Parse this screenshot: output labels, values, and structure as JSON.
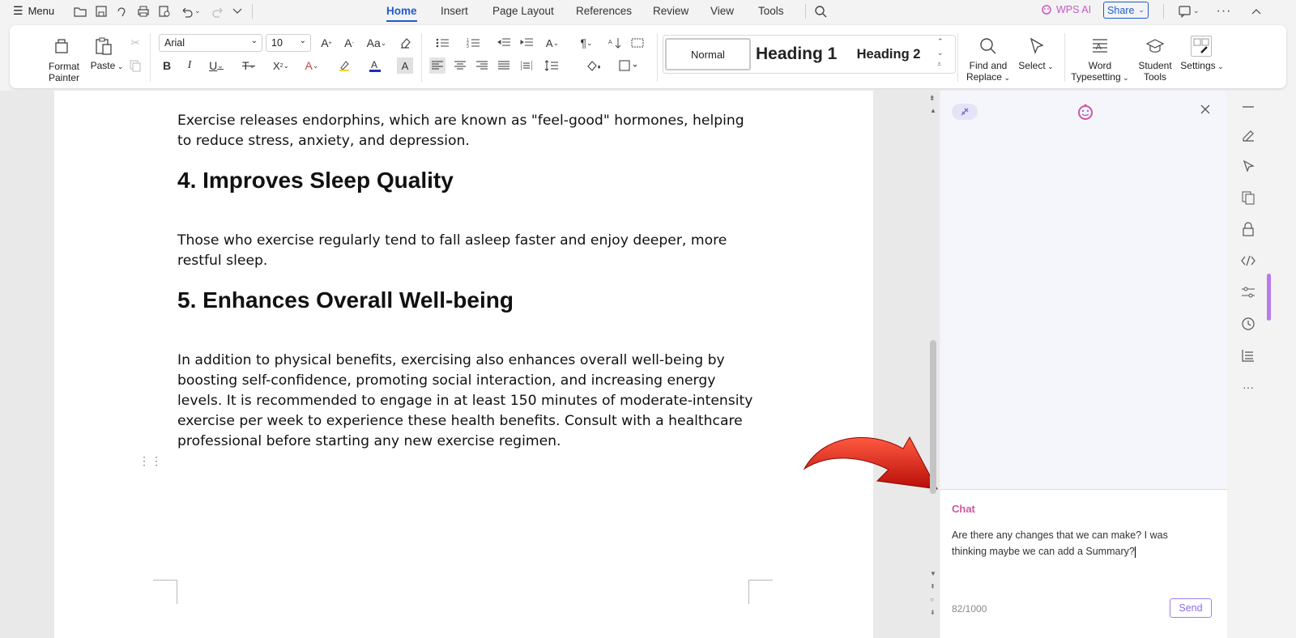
{
  "topbar": {
    "menu_label": "Menu",
    "tabs": [
      "Home",
      "Insert",
      "Page Layout",
      "References",
      "Review",
      "View",
      "Tools"
    ],
    "active_tab": "Home",
    "wps_ai": "WPS AI",
    "share": "Share"
  },
  "ribbon": {
    "format_painter": "Format Painter",
    "paste": "Paste",
    "font_name": "Arial",
    "font_size": "10",
    "styles": {
      "normal": "Normal",
      "heading1": "Heading 1",
      "heading2": "Heading 2"
    },
    "find_replace": "Find and Replace",
    "select": "Select",
    "word_typesetting": "Word Typesetting",
    "student_tools": "Student Tools",
    "settings": "Settings"
  },
  "document": {
    "para1": "Exercise releases endorphins, which are known as \"feel-good\" hormones, helping to reduce stress, anxiety, and depression.",
    "heading4": "4. Improves Sleep Quality",
    "para2": "Those who exercise regularly tend to fall asleep faster and enjoy deeper, more restful sleep.",
    "heading5": "5. Enhances Overall Well-being",
    "para3": "In addition to physical benefits, exercising also enhances overall well-being by boosting self-confidence, promoting social interaction, and increasing energy levels. It is recommended to engage in at least 150 minutes of moderate-intensity exercise per week to experience these health benefits. Consult with a healthcare professional before starting any new exercise regimen."
  },
  "ai_panel": {
    "chat_label": "Chat",
    "input_text": "Are there any changes that we can make? I was thinking maybe we can add a Summary?",
    "char_count": "82/1000",
    "send": "Send"
  },
  "colors": {
    "accent": "#1f5bd1",
    "ai_pink": "#d2569c",
    "ai_purple": "#8b6cf0",
    "arrow_red": "#d81e10"
  }
}
